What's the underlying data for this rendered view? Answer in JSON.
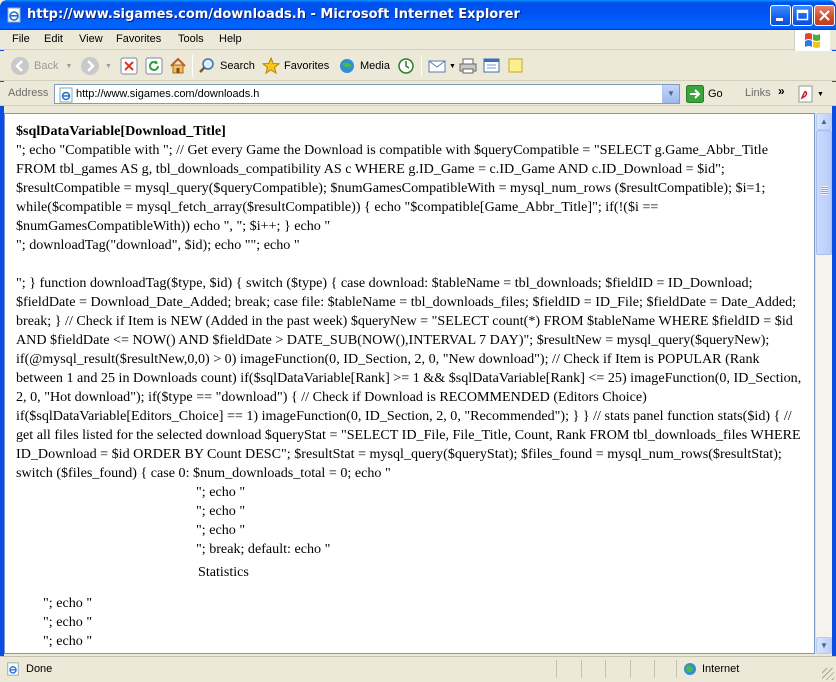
{
  "window": {
    "title": "http://www.sigames.com/downloads.h - Microsoft Internet Explorer",
    "controls": [
      "minimize",
      "maximize",
      "close"
    ]
  },
  "menu": [
    {
      "label": "File",
      "hotkey": "F"
    },
    {
      "label": "Edit",
      "hotkey": "E"
    },
    {
      "label": "View",
      "hotkey": "V"
    },
    {
      "label": "Favorites",
      "hotkey": "a"
    },
    {
      "label": "Tools",
      "hotkey": "T"
    },
    {
      "label": "Help",
      "hotkey": "H"
    }
  ],
  "toolbar": {
    "back_label": "Back",
    "search_label": "Search",
    "favorites_label": "Favorites",
    "media_label": "Media"
  },
  "address": {
    "label": "Address",
    "url": "http://www.sigames.com/downloads.h",
    "go_label": "Go",
    "links_label": "Links",
    "links_chevron": "»"
  },
  "content": {
    "heading": "$sqlDataVariable[Download_Title]",
    "block1": "\"; echo \"Compatible with \"; // Get every Game the Download is compatible with $queryCompatible = \"SELECT g.Game_Abbr_Title FROM tbl_games AS g, tbl_downloads_compatibility AS c WHERE g.ID_Game = c.ID_Game AND c.ID_Download = $id\"; $resultCompatible = mysql_query($queryCompatible); $numGamesCompatibleWith = mysql_num_rows ($resultCompatible); $i=1; while($compatible = mysql_fetch_array($resultCompatible)) { echo \"$compatible[Game_Abbr_Title]\"; if(!($i == $numGamesCompatibleWith)) echo \", \"; $i++; } echo \"",
    "block2": "\"; downloadTag(\"download\", $id); echo \"\"; echo \"",
    "block3": "\"; } function downloadTag($type, $id) { switch ($type) { case download: $tableName = tbl_downloads; $fieldID = ID_Download; $fieldDate = Download_Date_Added; break; case file: $tableName = tbl_downloads_files; $fieldID = ID_File; $fieldDate = Date_Added; break; } // Check if Item is NEW (Added in the past week) $queryNew = \"SELECT count(*) FROM $tableName WHERE $fieldID = $id AND $fieldDate <= NOW() AND $fieldDate > DATE_SUB(NOW(),INTERVAL 7 DAY)\"; $resultNew = mysql_query($queryNew); if(@mysql_result($resultNew,0,0) > 0) imageFunction(0, ID_Section, 2, 0, \"New download\"); // Check if Item is POPULAR (Rank between 1 and 25 in Downloads count) if($sqlDataVariable[Rank] >= 1 && $sqlDataVariable[Rank] <= 25) imageFunction(0, ID_Section, 2, 0, \"Hot download\"); if($type == \"download\") { // Check if Download is RECOMMENDED (Editors Choice) if($sqlDataVariable[Editors_Choice] == 1) imageFunction(0, ID_Section, 2, 0, \"Recommended\"); } } // stats panel function stats($id) { // get all files listed for the selected download $queryStat = \"SELECT ID_File, File_Title, Count, Rank FROM tbl_downloads_files WHERE ID_Download = $id ORDER BY Count DESC\"; $resultStat = mysql_query($queryStat); $files_found = mysql_num_rows($resultStat); switch ($files_found) { case 0: $num_downloads_total = 0; echo \"",
    "indented": [
      "\"; echo \"",
      "\"; echo \"",
      "\"; echo \"",
      "\"; break; default: echo \""
    ],
    "statistics": "Statistics",
    "indented2": [
      "\"; echo \"",
      "\"; echo \"",
      "\"; echo \""
    ]
  },
  "status": {
    "text": "Done",
    "zone": "Internet"
  }
}
